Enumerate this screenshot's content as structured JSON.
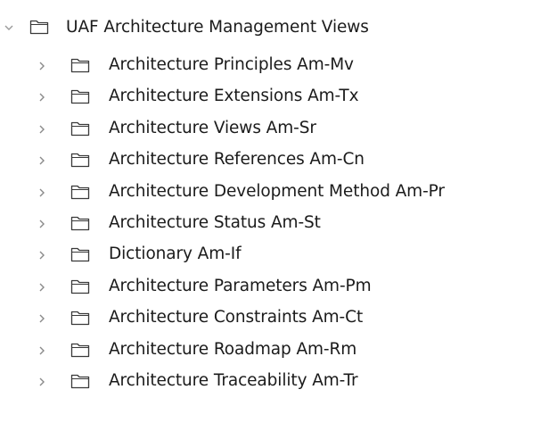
{
  "tree": {
    "root": {
      "label": "UAF Architecture Management Views",
      "expanded": true,
      "icon": "folder-icon"
    },
    "children": [
      {
        "label": "Architecture Principles Am-Mv",
        "icon": "folder-icon",
        "expander": "chevron-right-icon"
      },
      {
        "label": "Architecture Extensions Am-Tx",
        "icon": "folder-icon",
        "expander": "chevron-right-icon"
      },
      {
        "label": "Architecture Views Am-Sr",
        "icon": "folder-icon",
        "expander": "chevron-right-icon"
      },
      {
        "label": "Architecture References Am-Cn",
        "icon": "folder-icon",
        "expander": "chevron-right-icon"
      },
      {
        "label": "Architecture Development Method Am-Pr",
        "icon": "folder-icon",
        "expander": "chevron-right-icon"
      },
      {
        "label": "Architecture Status Am-St",
        "icon": "folder-icon",
        "expander": "chevron-right-icon"
      },
      {
        "label": "Dictionary Am-If",
        "icon": "folder-icon",
        "expander": "chevron-right-icon"
      },
      {
        "label": "Architecture Parameters Am-Pm",
        "icon": "folder-icon",
        "expander": "chevron-right-icon"
      },
      {
        "label": "Architecture Constraints Am-Ct",
        "icon": "folder-icon",
        "expander": "chevron-right-icon"
      },
      {
        "label": "Architecture Roadmap Am-Rm",
        "icon": "folder-icon",
        "expander": "chevron-right-icon"
      },
      {
        "label": "Architecture Traceability Am-Tr",
        "icon": "folder-icon",
        "expander": "chevron-right-icon"
      }
    ]
  }
}
